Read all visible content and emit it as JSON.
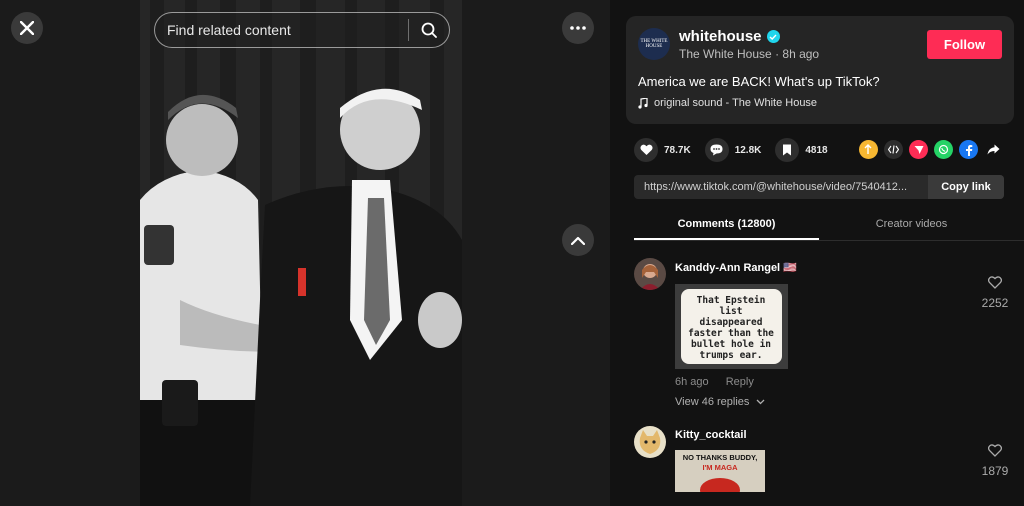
{
  "search": {
    "placeholder": "Find related content"
  },
  "post": {
    "username": "whitehouse",
    "nickname": "The White House",
    "time": "8h ago",
    "follow_label": "Follow",
    "caption": "America we are BACK! What's up TikTok?",
    "sound": "original sound - The White House",
    "avatar_text": "THE WHITE HOUSE"
  },
  "stats": {
    "likes": "78.7K",
    "comments": "12.8K",
    "saves": "4818"
  },
  "share_icons": [
    "repost-icon",
    "embed-icon",
    "send-icon",
    "whatsapp-icon",
    "facebook-icon",
    "share-arrow-icon"
  ],
  "link": {
    "url": "https://www.tiktok.com/@whitehouse/video/7540412...",
    "copy_label": "Copy link"
  },
  "tabs": [
    {
      "label": "Comments (12800)",
      "active": true
    },
    {
      "label": "Creator videos",
      "active": false
    }
  ],
  "comments": [
    {
      "name": "Kanddy-Ann Rangel 🇺🇸",
      "image_text": "That Epstein list disappeared faster than the bullet hole in trumps ear.",
      "time": "6h ago",
      "reply": "Reply",
      "view_replies": "View 46 replies",
      "likes": "2252"
    },
    {
      "name": "Kitty_cocktail",
      "image_text_top": "NO THANKS BUDDY,",
      "image_text_bottom": "I'M MAGA",
      "likes": "1879"
    }
  ],
  "colors": {
    "accent": "#fe2c55",
    "background": "#121212",
    "card": "#252525",
    "verified": "#20d5ec"
  }
}
